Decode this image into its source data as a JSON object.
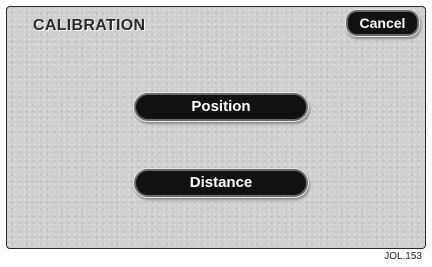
{
  "screen": {
    "title": "CALIBRATION",
    "cancel_label": "Cancel"
  },
  "menu": {
    "position_label": "Position",
    "distance_label": "Distance"
  },
  "footer": {
    "code": "JOL.153"
  }
}
